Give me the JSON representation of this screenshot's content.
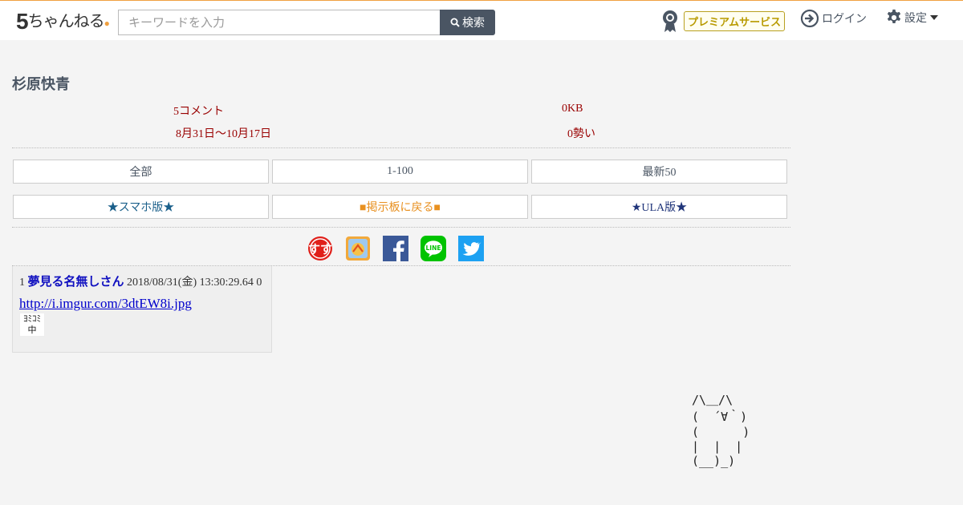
{
  "header": {
    "logo_text": "ちゃんねる",
    "logo_number": "5",
    "search_placeholder": "キーワードを入力",
    "search_button": "検索",
    "premium_label": "プレミアムサービス",
    "login_label": "ログイン",
    "settings_label": "設定"
  },
  "thread": {
    "title": "杉原快青",
    "comments": "5コメント",
    "size": "0KB",
    "dates": "8月31日〜10月17日",
    "speed": "0勢い"
  },
  "nav": {
    "all": "全部",
    "range": "1-100",
    "latest": "最新50",
    "smartphone": "★スマホ版★",
    "back": "■掲示板に戻る■",
    "ula": "★ULA版★"
  },
  "share_icons": [
    "hatena-icon",
    "pocket-icon",
    "facebook-icon",
    "line-icon",
    "twitter-icon"
  ],
  "post": {
    "number": "1",
    "name": "夢見る名無しさん",
    "datetime": "2018/08/31(金) 13:30:29.64",
    "id": "0",
    "link": "http://i.imgur.com/3dtEW8i.jpg",
    "image_text_top": "ﾖﾐｺﾐ",
    "image_text_bottom": "中"
  },
  "ascii_art": "/\\＿/\\\n(  ´∀｀)\n(      )\n|  |  |\n(__)_)",
  "colors": {
    "accent": "#f0a040",
    "header_button": "#4a5563",
    "stat_text": "#990000",
    "name_blue": "#1010c0",
    "premium_gold": "#b89a00"
  }
}
